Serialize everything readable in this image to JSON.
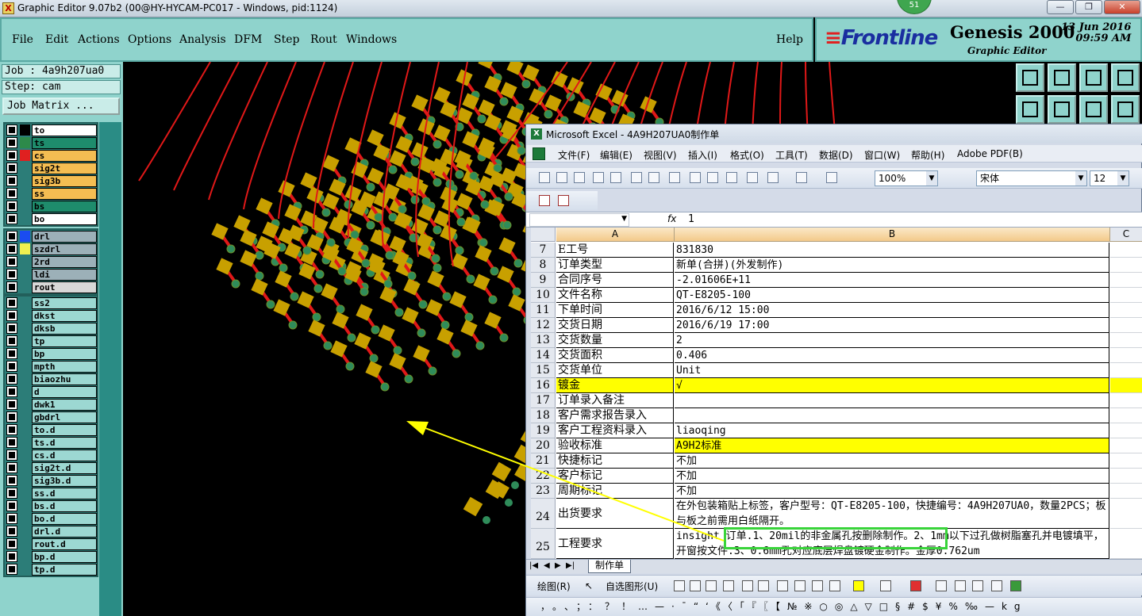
{
  "window": {
    "title": "Graphic Editor 9.07b2 (00@HY-HYCAM-PC017 - Windows, pid:1124)",
    "badge": "51",
    "buttons": [
      "—",
      "❐",
      "✕"
    ]
  },
  "menu": {
    "items": [
      "File",
      "Edit",
      "Actions",
      "Options",
      "Analysis",
      "DFM",
      "Step",
      "Rout",
      "Windows"
    ],
    "help": "Help"
  },
  "brand": {
    "logo": "Frontline",
    "product": "Genesis 2000",
    "subtitle": "Graphic Editor",
    "date": "13 Jun 2016",
    "time": "09:59 AM"
  },
  "left": {
    "job": "Job : 4a9h207ua0",
    "step": "Step: cam",
    "job_matrix": "Job Matrix ..."
  },
  "layers": {
    "group1": [
      {
        "name": "to",
        "swatch": "#000000",
        "bg": "#ffffff"
      },
      {
        "name": "ts",
        "swatch": "#2d8a4a",
        "bg": "#1e8c6c"
      },
      {
        "name": "cs",
        "swatch": "#e02020",
        "bg": "#f4bd52"
      },
      {
        "name": "sig2t",
        "swatch": "#2c7d78",
        "bg": "#f4bd52"
      },
      {
        "name": "sig3b",
        "swatch": "#2c7d78",
        "bg": "#f4bd52"
      },
      {
        "name": "ss",
        "swatch": "#2c7d78",
        "bg": "#f4bd52"
      },
      {
        "name": "bs",
        "swatch": "#2c7d78",
        "bg": "#1e8c6c"
      },
      {
        "name": "bo",
        "swatch": "#2c7d78",
        "bg": "#ffffff"
      }
    ],
    "group2": [
      {
        "name": "drl",
        "swatch": "#1a4cf0",
        "bg": "#9cb0b8"
      },
      {
        "name": "szdrl",
        "swatch": "#f0f050",
        "bg": "#9cb0b8"
      },
      {
        "name": "2rd",
        "swatch": "#2c7d78",
        "bg": "#9cb0b8"
      },
      {
        "name": "ldi",
        "swatch": "#2c7d78",
        "bg": "#9cb0b8"
      },
      {
        "name": "rout",
        "swatch": "#2c7d78",
        "bg": "#d8d8d8"
      }
    ],
    "group3": [
      "ss2",
      "dkst",
      "dksb",
      "tp",
      "bp",
      "mpth",
      "biaozhu",
      "d",
      "dwk1",
      "gbdrl",
      "to.d",
      "ts.d",
      "cs.d",
      "sig2t.d",
      "sig3b.d",
      "ss.d",
      "bs.d",
      "bo.d",
      "drl.d",
      "rout.d",
      "bp.d",
      "tp.d"
    ]
  },
  "excel": {
    "title": "Microsoft Excel - 4A9H207UA0制作单",
    "menu": [
      "文件(F)",
      "编辑(E)",
      "视图(V)",
      "插入(I)",
      "格式(O)",
      "工具(T)",
      "数据(D)",
      "窗口(W)",
      "帮助(H)",
      "Adobe PDF(B)"
    ],
    "zoom": "100%",
    "font": "宋体",
    "size": "12",
    "formula_value": "1",
    "fx": "fx",
    "columns": [
      "A",
      "B",
      "C"
    ],
    "rows": [
      {
        "n": "7",
        "a": "E工号",
        "b": "831830"
      },
      {
        "n": "8",
        "a": "订单类型",
        "b": "新单(合拼)(外发制作)"
      },
      {
        "n": "9",
        "a": "合同序号",
        "b": "-2.01606E+11"
      },
      {
        "n": "10",
        "a": "文件名称",
        "b": "QT-E8205-100"
      },
      {
        "n": "11",
        "a": "下单时间",
        "b": "2016/6/12 15:00"
      },
      {
        "n": "12",
        "a": "交货日期",
        "b": "2016/6/19 17:00"
      },
      {
        "n": "13",
        "a": "交货数量",
        "b": "2"
      },
      {
        "n": "14",
        "a": "交货面积",
        "b": "0.406"
      },
      {
        "n": "15",
        "a": "交货单位",
        "b": "Unit"
      },
      {
        "n": "16",
        "a": "镀金",
        "b": "√"
      },
      {
        "n": "17",
        "a": "订单录入备注",
        "b": ""
      },
      {
        "n": "18",
        "a": "客户需求报告录入",
        "b": ""
      },
      {
        "n": "19",
        "a": "客户工程资料录入",
        "b": "liaoqing"
      },
      {
        "n": "20",
        "a": "验收标准",
        "b": "A9H2标准"
      },
      {
        "n": "21",
        "a": "快捷标记",
        "b": "不加"
      },
      {
        "n": "22",
        "a": "客户标记",
        "b": "不加"
      },
      {
        "n": "23",
        "a": "周期标记",
        "b": "不加"
      },
      {
        "n": "24",
        "a": "出货要求",
        "b": "在外包装箱贴上标签，客户型号：QT-E8205-100，快捷编号：4A9H207UA0，数量2PCS；板与板之前需用白纸隔开。"
      },
      {
        "n": "25",
        "a": "工程要求",
        "b": "insight 订单.1、20mil的非金属孔按删除制作。2、1mm以下过孔做树脂塞孔并电镀填平，开窗按文件.3、0.6mm孔对应底层焊盘镀硬金制作。金厚0.762um"
      }
    ],
    "sheet_tab": "制作单",
    "nav": [
      "|◀",
      "◀",
      "▶",
      "▶|"
    ],
    "draw_label": "绘图(R)",
    "autoshape_label": "自选图形(U)",
    "symbols": "，。、；：？！…—·ˉ“‘《〈「『〖【№※○◎△▽□§#$¥%‰—kg"
  },
  "colors": {
    "genesis_panel": "#8fd3cc",
    "pad": "#c8a000",
    "trace": "#e01818",
    "via": "#2f8c5a",
    "highlight": "#ffff00",
    "callout": "#39d43a"
  }
}
